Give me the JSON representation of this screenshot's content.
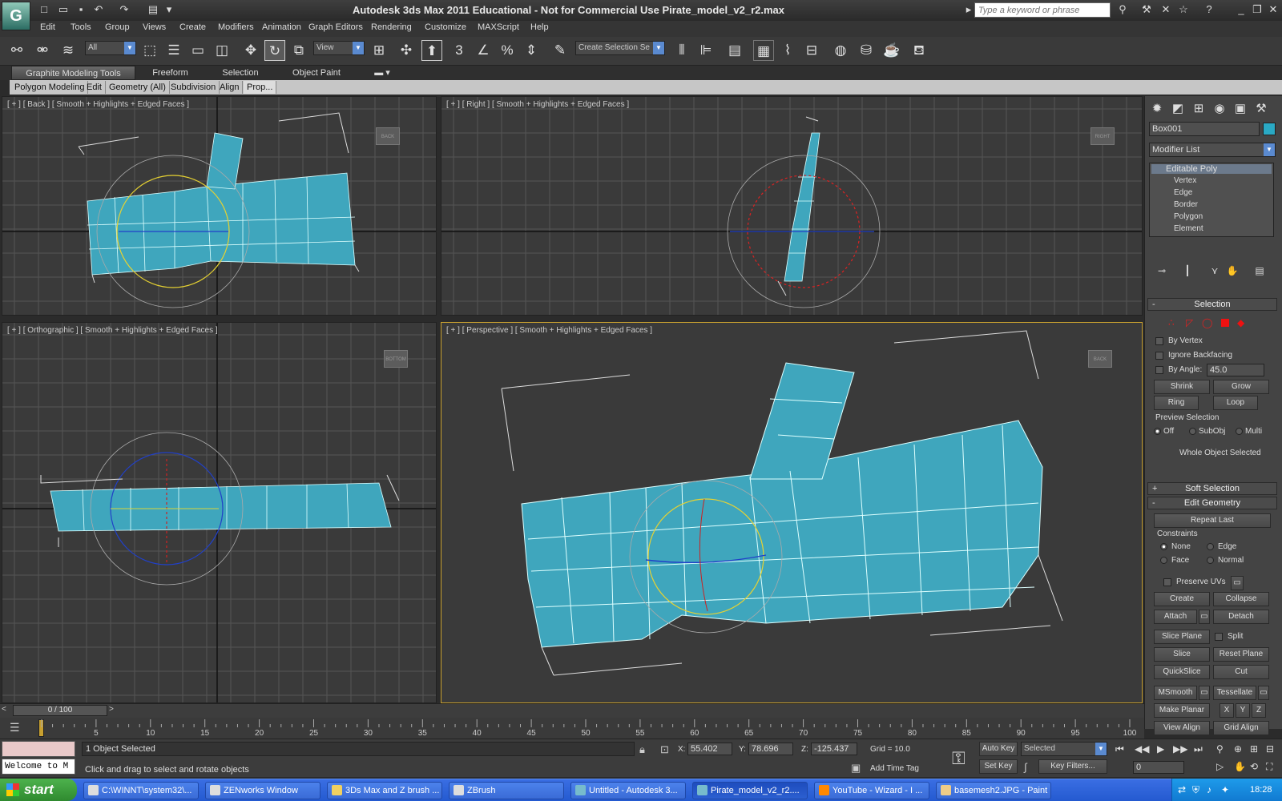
{
  "app": {
    "logo_glyph": "G",
    "title": "Autodesk 3ds Max  2011    Educational - Not for Commercial Use    Pirate_model_v2_r2.max",
    "search_placeholder": "Type a keyword or phrase"
  },
  "menu": [
    "Edit",
    "Tools",
    "Group",
    "Views",
    "Create",
    "Modifiers",
    "Animation",
    "Graph Editors",
    "Rendering",
    "Customize",
    "MAXScript",
    "Help"
  ],
  "toolbar": {
    "selection_filter": "All",
    "ref_coord": "View",
    "named_selection": "Create Selection Se"
  },
  "ribbon": {
    "tabs": [
      "Graphite Modeling Tools",
      "Freeform",
      "Selection",
      "Object Paint"
    ],
    "subtabs": [
      "Polygon Modeling",
      "Edit",
      "Geometry (All)",
      "Subdivision",
      "Align",
      "Prop..."
    ]
  },
  "viewports": {
    "back": {
      "label": "[ + ] [ Back ] [ Smooth + Highlights + Edged Faces ]",
      "cube": "BACK"
    },
    "right": {
      "label": "[ + ] [ Right ] [ Smooth + Highlights + Edged Faces ]",
      "cube": "RIGHT"
    },
    "ortho": {
      "label": "[ + ] [ Orthographic ] [ Smooth + Highlights + Edged Faces ]",
      "cube": "BOTTOM"
    },
    "persp": {
      "label": "[ + ] [ Perspective ] [ Smooth + Highlights + Edged Faces ]",
      "cube": "BACK"
    }
  },
  "command_panel": {
    "object_name": "Box001",
    "object_color": "#2aa9c4",
    "modifier_list": "Modifier List",
    "stack": [
      "Editable Poly",
      "Vertex",
      "Edge",
      "Border",
      "Polygon",
      "Element"
    ],
    "selection": {
      "title": "Selection",
      "by_vertex": "By Vertex",
      "ignore_backfacing": "Ignore Backfacing",
      "by_angle": "By Angle:",
      "angle_value": "45.0",
      "shrink": "Shrink",
      "grow": "Grow",
      "ring": "Ring",
      "loop": "Loop",
      "preview_selection": "Preview Selection",
      "off": "Off",
      "subobj": "SubObj",
      "multi": "Multi",
      "status": "Whole Object Selected"
    },
    "soft_selection": "Soft Selection",
    "edit_geometry": {
      "title": "Edit Geometry",
      "repeat_last": "Repeat Last",
      "constraints": "Constraints",
      "none": "None",
      "edge": "Edge",
      "face": "Face",
      "normal": "Normal",
      "preserve_uvs": "Preserve UVs",
      "create": "Create",
      "collapse": "Collapse",
      "attach": "Attach",
      "detach": "Detach",
      "slice_plane": "Slice Plane",
      "split": "Split",
      "slice": "Slice",
      "reset_plane": "Reset Plane",
      "quickslice": "QuickSlice",
      "cut": "Cut",
      "msmooth": "MSmooth",
      "tessellate": "Tessellate",
      "make_planar": "Make Planar",
      "x": "X",
      "y": "Y",
      "z": "Z",
      "view_align": "View Align",
      "grid_align": "Grid Align"
    }
  },
  "timeline": {
    "frame": "0 / 100",
    "ticks": [
      "5",
      "10",
      "15",
      "20",
      "25",
      "30",
      "35",
      "40",
      "45",
      "50",
      "55",
      "60",
      "65",
      "70",
      "75",
      "80",
      "85",
      "90",
      "95",
      "100"
    ],
    "frame_start": 0,
    "frame_end": 100
  },
  "status": {
    "maxscript": "Welcome to M",
    "selected": "1 Object Selected",
    "prompt": "Click and drag to select and rotate objects",
    "x_label": "X:",
    "x_value": "55.402",
    "y_label": "Y:",
    "y_value": "78.696",
    "z_label": "Z:",
    "z_value": "-125.437",
    "grid": "Grid = 10.0",
    "add_time_tag": "Add Time Tag",
    "auto_key": "Auto Key",
    "set_key": "Set Key",
    "key_mode": "Selected",
    "key_filters": "Key Filters...",
    "current_frame": "0"
  },
  "taskbar": {
    "start": "start",
    "items": [
      "C:\\WINNT\\system32\\...",
      "ZENworks Window",
      "3Ds Max and Z brush ...",
      "ZBrush",
      "Untitled - Autodesk 3...",
      "Pirate_model_v2_r2....",
      "YouTube - Wizard - I ...",
      "basemesh2.JPG - Paint"
    ],
    "active_index": 5,
    "clock": "18:28"
  }
}
